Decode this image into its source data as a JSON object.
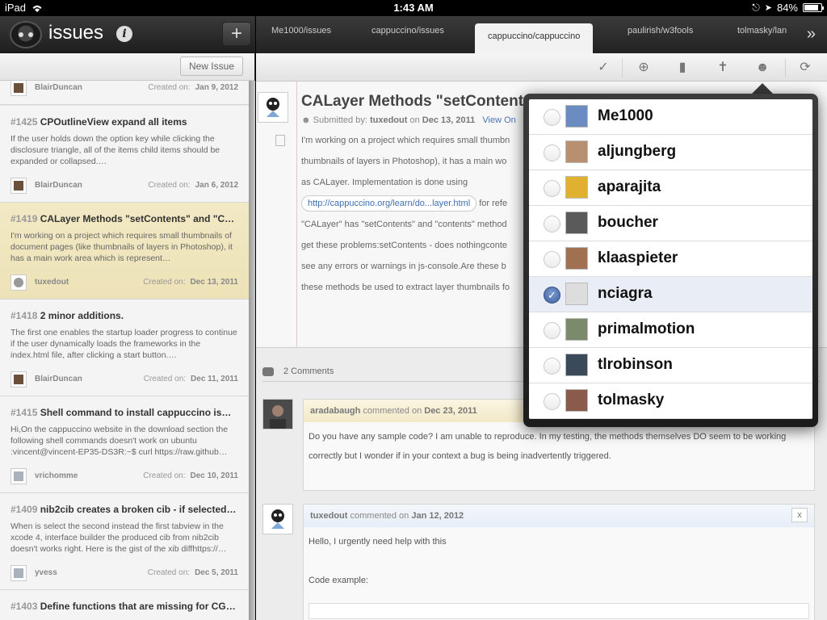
{
  "statusbar": {
    "device": "iPad",
    "time": "1:43 AM",
    "battery": "84%"
  },
  "sidebar": {
    "app_title": "issues",
    "new_issue_label": "New Issue",
    "created_label": "Created on:",
    "issues": [
      {
        "number": "",
        "title": "",
        "desc": "",
        "user": "BlairDuncan",
        "date": "Jan 9, 2012"
      },
      {
        "number": "#1425",
        "title": "CPOutlineView  expand all items",
        "desc": "If the user holds down the option key while clicking the disclosure triangle, all of the items child items should be expanded or collapsed.…",
        "user": "BlairDuncan",
        "date": "Jan 6, 2012"
      },
      {
        "number": "#1419",
        "title": "CALayer Methods \"setContents\" and \"C…",
        "desc": "I'm working on a project which requires small thumbnails of document pages (like thumbnails of layers in Photoshop), it has a main work area which is represent…",
        "user": "tuxedout",
        "date": "Dec 13, 2011"
      },
      {
        "number": "#1418",
        "title": "2 minor additions.",
        "desc": "The first one enables the startup loader progress to continue if the user dynamically loads the frameworks in the index.html file, after clicking a start button.…",
        "user": "BlairDuncan",
        "date": "Dec 11, 2011"
      },
      {
        "number": "#1415",
        "title": "Shell command to install cappuccino is…",
        "desc": "Hi,On the cappuccino website in the download section the following shell commands doesn't work on ubuntu :vincent@vincent-EP35-DS3R:~$ curl https://raw.github…",
        "user": "vrichomme",
        "date": "Dec 10, 2011"
      },
      {
        "number": "#1409",
        "title": "nib2cib creates a broken cib - if selected…",
        "desc": "When is select the second instead the first tabview in the xcode 4,  interface builder the produced cib from nib2cib doesn't works right. Here is the gist of the xib diffhttps://…",
        "user": "yvess",
        "date": "Dec 5, 2011"
      },
      {
        "number": "#1403",
        "title": "Define functions that are missing for CG…",
        "desc": "",
        "user": "",
        "date": ""
      }
    ]
  },
  "tabs": [
    "Me1000/issues",
    "cappuccino/issues",
    "cappuccino/cappuccino",
    "paulirish/w3fools",
    "tolmasky/lan"
  ],
  "issue": {
    "title": "CALayer Methods \"setContents\"",
    "submitted_prefix": "Submitted by:",
    "author": "tuxedout",
    "on": "on",
    "date": "Dec 13, 2011",
    "view_on": "View On",
    "body_lines": [
      "I'm working on a project which requires small thumbn",
      "thumbnails of layers in Photoshop), it has a main wo",
      "as CALayer. Implementation is done using",
      "",
      "\"CALayer\" has \"setContents\" and \"contents\" method",
      "get these problems:setContents - does nothingconte",
      "see any errors or warnings in js-console.Are these b",
      "these methods be used to extract layer thumbnails fo"
    ],
    "url": "http://cappuccino.org/learn/do...layer.html",
    "url_tail": "for refe"
  },
  "comments": {
    "count_label": "2 Comments",
    "items": [
      {
        "user": "aradabaugh",
        "verb": "commented on",
        "date": "Dec 23, 2011",
        "text": "Do you have any sample code? I am unable to reproduce. In my testing, the methods themselves DO seem to be working correctly but I wonder if in your context a bug is being inadvertently triggered."
      },
      {
        "user": "tuxedout",
        "verb": "commented on",
        "date": "Jan 12, 2012",
        "line1": "Hello, I urgently need help with this",
        "line2": "Code example:",
        "close": "x"
      }
    ]
  },
  "assignees": [
    {
      "name": "Me1000",
      "checked": false,
      "color": "#6a8cc0"
    },
    {
      "name": "aljungberg",
      "checked": false,
      "color": "#b89070"
    },
    {
      "name": "aparajita",
      "checked": false,
      "color": "#e0b030"
    },
    {
      "name": "boucher",
      "checked": false,
      "color": "#5a5a5a"
    },
    {
      "name": "klaaspieter",
      "checked": false,
      "color": "#a07050"
    },
    {
      "name": "nciagra",
      "checked": true,
      "color": "#dddddd"
    },
    {
      "name": "primalmotion",
      "checked": false,
      "color": "#7a8a6a"
    },
    {
      "name": "tlrobinson",
      "checked": false,
      "color": "#3a4a5a"
    },
    {
      "name": "tolmasky",
      "checked": false,
      "color": "#8a5a4a"
    }
  ]
}
